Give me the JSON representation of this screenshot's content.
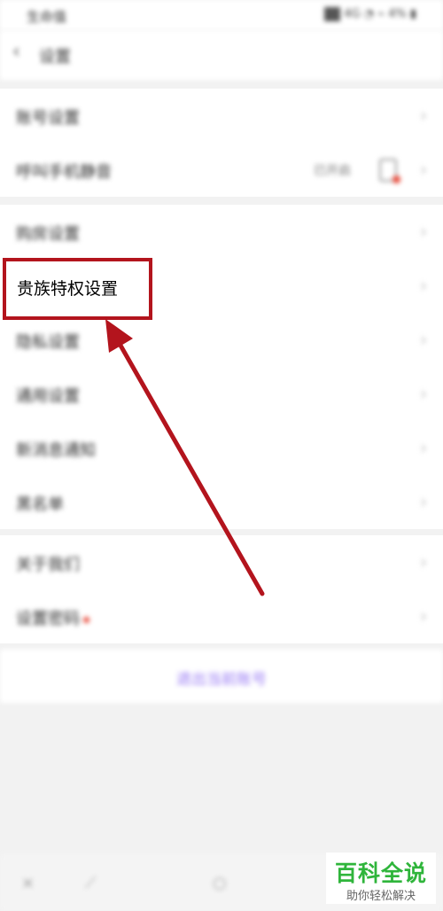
{
  "status_bar": {
    "time": "生命值",
    "icons": "4G ◔ ⌁ 4% ▮"
  },
  "nav": {
    "back_icon": "chevron-left-icon",
    "title": "设置"
  },
  "groups": [
    {
      "items": [
        {
          "label": "账号设置"
        },
        {
          "label": "呼叫手机静音",
          "value": "已开启"
        }
      ]
    },
    {
      "items": [
        {
          "label": "购房设置"
        },
        {
          "label": "贵族特权设置",
          "highlighted": true
        },
        {
          "label": "隐私设置"
        },
        {
          "label": "通用设置"
        },
        {
          "label": "新消息通知"
        },
        {
          "label": "黑名单"
        }
      ]
    },
    {
      "items": [
        {
          "label": "关于我们"
        },
        {
          "label": "设置密码",
          "badge_color": "#e84a3a"
        }
      ]
    }
  ],
  "logout": {
    "label": "退出当前账号"
  },
  "bottom_nav": [
    "×",
    "⟋",
    "○"
  ],
  "annotation": {
    "box_color": "#b3141d",
    "arrow_color": "#b3141d"
  },
  "watermark": {
    "line1": "百科全说",
    "line2": "助你轻松解决"
  },
  "colors": {
    "accent": "#9a7cf4",
    "brand_green": "#2fb53b"
  }
}
